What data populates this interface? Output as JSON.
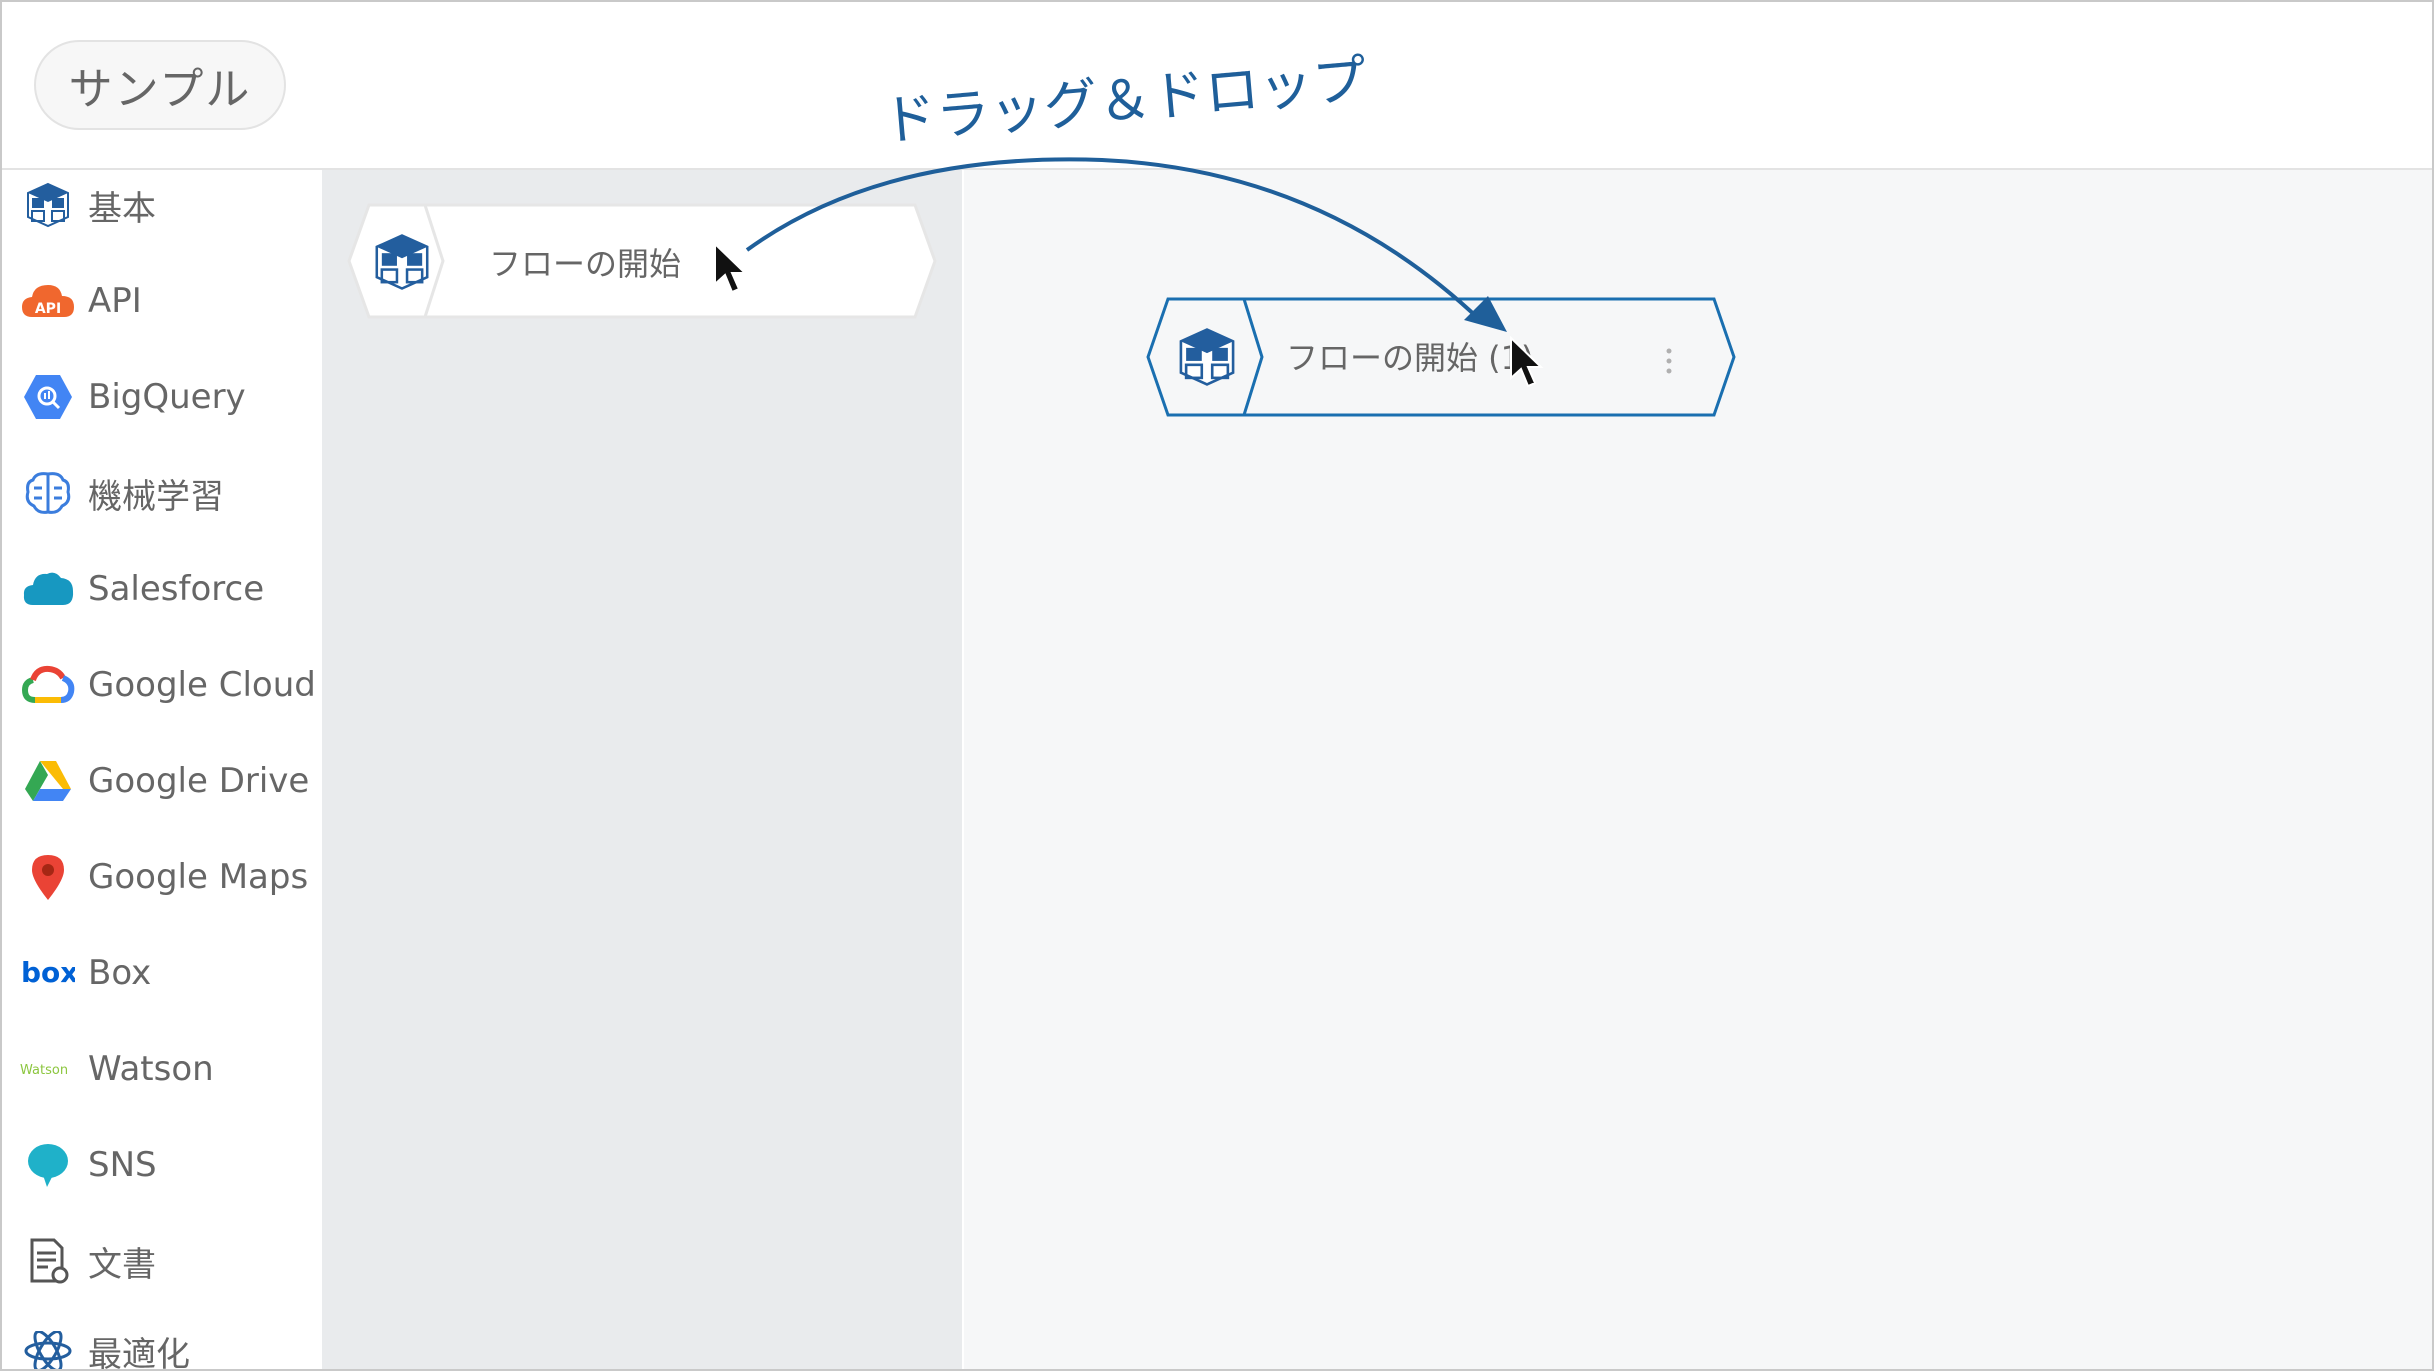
{
  "header": {
    "title": "サンプル"
  },
  "sidebar": {
    "items": [
      {
        "label": "基本",
        "icon": "blocks-icon"
      },
      {
        "label": "API",
        "icon": "api-cloud-icon"
      },
      {
        "label": "BigQuery",
        "icon": "bigquery-icon"
      },
      {
        "label": "機械学習",
        "icon": "brain-icon"
      },
      {
        "label": "Salesforce",
        "icon": "salesforce-cloud-icon"
      },
      {
        "label": "Google Cloud",
        "icon": "google-cloud-icon"
      },
      {
        "label": "Google Drive",
        "icon": "google-drive-icon"
      },
      {
        "label": "Google Maps",
        "icon": "map-pin-icon"
      },
      {
        "label": "Box",
        "icon": "box-logo-icon"
      },
      {
        "label": "Watson",
        "icon": "watson-logo-icon"
      },
      {
        "label": "SNS",
        "icon": "chat-bubble-icon"
      },
      {
        "label": "文書",
        "icon": "document-icon"
      },
      {
        "label": "最適化",
        "icon": "atom-icon"
      }
    ]
  },
  "palette": {
    "node_label": "フローの開始"
  },
  "canvas": {
    "node_label": "フローの開始 (1)"
  },
  "annotation": {
    "label": "ドラッグ＆ドロップ"
  },
  "colors": {
    "accent": "#1f5f9a",
    "node_border": "#1a6fb0",
    "icon_blue": "#235e9e"
  }
}
